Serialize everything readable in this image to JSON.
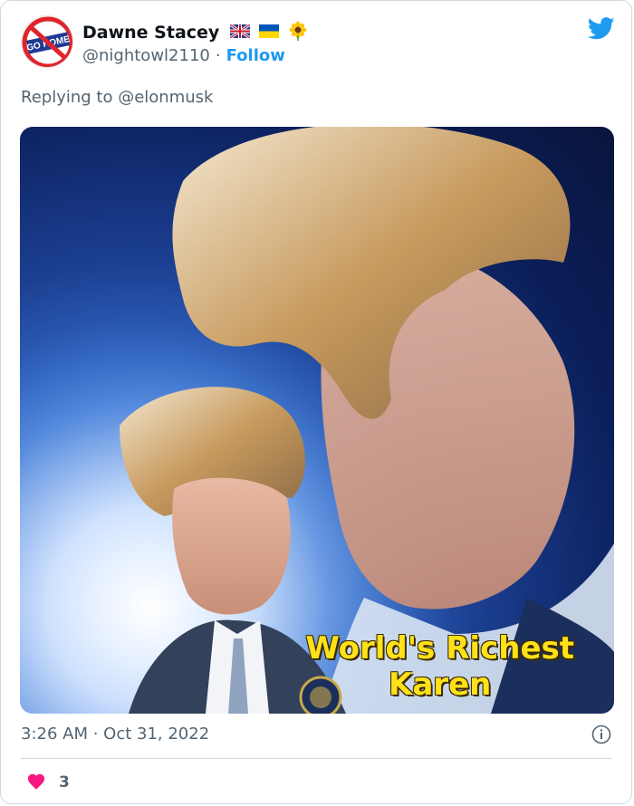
{
  "tweet": {
    "author_name": "Dawne Stacey",
    "handle": "@nightowl2110",
    "separator": "·",
    "follow_label": "Follow",
    "flags": [
      "uk-flag-icon",
      "ukraine-flag-icon",
      "sunflower-icon"
    ],
    "avatar_text": "GO HOME",
    "replying_prefix": "Replying to",
    "replying_to": "@elonmusk",
    "media_caption_line1": "World's Richest",
    "media_caption_line2": "Karen",
    "timestamp": "3:26 AM · Oct 31, 2022",
    "like_count": "3"
  },
  "colors": {
    "twitter_blue": "#1d9bf0",
    "muted_text": "#536471",
    "heart": "#f91880",
    "caption_yellow": "#ffe11a"
  }
}
